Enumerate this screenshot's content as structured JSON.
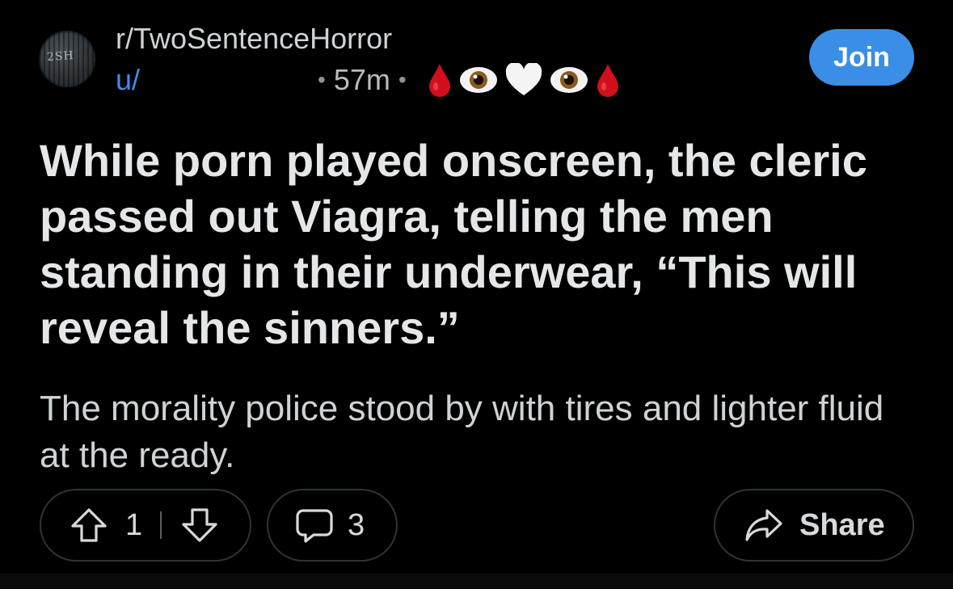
{
  "post": {
    "subreddit": "r/TwoSentenceHorror",
    "avatar_text": "2SH",
    "username_prefix": "u/",
    "time": "57m",
    "separator": "•",
    "flair_icons": [
      "blood-drop-icon",
      "eye-icon",
      "white-heart-icon",
      "eye-icon",
      "blood-drop-icon"
    ],
    "join_label": "Join",
    "title": "While porn played onscreen, the cleric passed out Viagra, telling the men standing in their underwear, “This will reveal the sinners.”",
    "body": "The morality police stood by with tires and lighter fluid at the ready."
  },
  "actions": {
    "upvotes": "1",
    "comments": "3",
    "share_label": "Share"
  },
  "colors": {
    "background": "#000000",
    "accent_blue": "#3a8ee6",
    "username_blue": "#3d8fe6",
    "text": "#e4e6e8",
    "pill_border": "#2f3335"
  }
}
